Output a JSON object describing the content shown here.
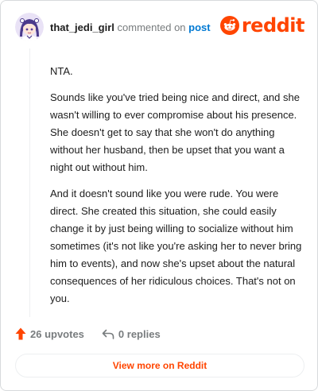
{
  "header": {
    "username": "that_jedi_girl",
    "action_text": "commented on",
    "post_link": "post",
    "logo_text": "reddit",
    "avatar_icon": "anime-girl-avatar-icon",
    "logo_icon": "reddit-snoo-icon"
  },
  "comment": {
    "paragraphs": [
      "NTA.",
      "Sounds like you've tried being nice and direct, and she wasn't willing to ever compromise about his presence. She doesn't get to say that she won't do anything without her husband, then be upset that you want a night out without him.",
      "And it doesn't sound like you were rude. You were direct. She created this situation, she could easily change it by just being willing to socialize without him sometimes (it's not like you're asking her to never bring him to events), and now she's upset about the natural consequences of her ridiculous choices. That's not on you."
    ]
  },
  "actions": {
    "upvotes": "26 upvotes",
    "replies": "0 replies",
    "upvote_icon": "upvote-arrow-icon",
    "reply_icon": "reply-arrow-icon"
  },
  "footer": {
    "view_more": "View more on Reddit"
  },
  "colors": {
    "brand": "#ff4500",
    "link": "#0079d3",
    "muted": "#787c7e",
    "text": "#1c1c1c",
    "border": "#d7dadc"
  }
}
